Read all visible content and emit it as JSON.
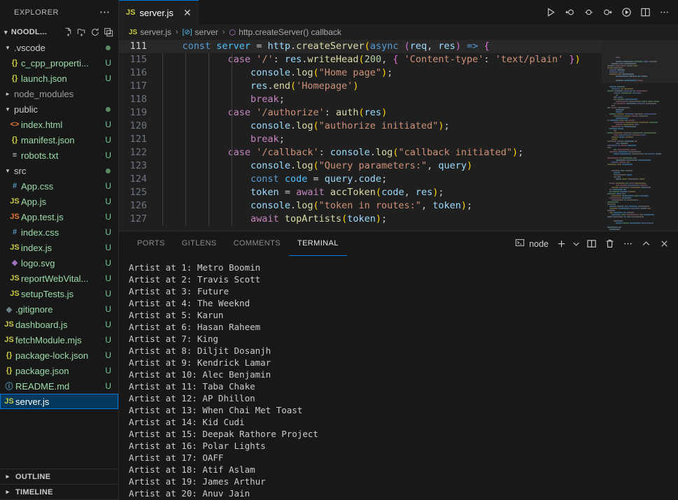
{
  "sidebar": {
    "title": "EXPLORER",
    "more_label": "⋯",
    "folder_name": "NOODL...",
    "actions": [
      {
        "name": "new-file-icon",
        "label": "New File"
      },
      {
        "name": "new-folder-icon",
        "label": "New Folder"
      },
      {
        "name": "refresh-icon",
        "label": "Refresh Explorer"
      },
      {
        "name": "collapse-all-icon",
        "label": "Collapse Folders in Explorer"
      }
    ],
    "tree": [
      {
        "label": ".vscode",
        "type": "folder",
        "expanded": true,
        "indent": 1,
        "icon": "",
        "badge": "dot",
        "cls": "d-folder"
      },
      {
        "label": "c_cpp_properti...",
        "type": "file",
        "indent": 2,
        "icon": "{}",
        "badge": "U",
        "cls": "json"
      },
      {
        "label": "launch.json",
        "type": "file",
        "indent": 2,
        "icon": "{}",
        "badge": "U",
        "cls": "json"
      },
      {
        "label": "node_modules",
        "type": "folder",
        "expanded": false,
        "indent": 1,
        "icon": "",
        "badge": "",
        "cls": "d-folder",
        "dim": true
      },
      {
        "label": "public",
        "type": "folder",
        "expanded": true,
        "indent": 1,
        "icon": "",
        "badge": "dot",
        "cls": "d-folder"
      },
      {
        "label": "index.html",
        "type": "file",
        "indent": 2,
        "icon": "<>",
        "badge": "U",
        "cls": "html"
      },
      {
        "label": "manifest.json",
        "type": "file",
        "indent": 2,
        "icon": "{}",
        "badge": "U",
        "cls": "json"
      },
      {
        "label": "robots.txt",
        "type": "file",
        "indent": 2,
        "icon": "≡",
        "badge": "U",
        "cls": "txt"
      },
      {
        "label": "src",
        "type": "folder",
        "expanded": true,
        "indent": 1,
        "icon": "",
        "badge": "dot",
        "cls": "d-folder"
      },
      {
        "label": "App.css",
        "type": "file",
        "indent": 2,
        "icon": "#",
        "badge": "U",
        "cls": "css"
      },
      {
        "label": "App.js",
        "type": "file",
        "indent": 2,
        "icon": "JS",
        "badge": "U",
        "cls": "js"
      },
      {
        "label": "App.test.js",
        "type": "file",
        "indent": 2,
        "icon": "JS",
        "badge": "U",
        "cls": "jst"
      },
      {
        "label": "index.css",
        "type": "file",
        "indent": 2,
        "icon": "#",
        "badge": "U",
        "cls": "css"
      },
      {
        "label": "index.js",
        "type": "file",
        "indent": 2,
        "icon": "JS",
        "badge": "U",
        "cls": "js"
      },
      {
        "label": "logo.svg",
        "type": "file",
        "indent": 2,
        "icon": "❖",
        "badge": "U",
        "cls": "svgc"
      },
      {
        "label": "reportWebVital...",
        "type": "file",
        "indent": 2,
        "icon": "JS",
        "badge": "U",
        "cls": "js"
      },
      {
        "label": "setupTests.js",
        "type": "file",
        "indent": 2,
        "icon": "JS",
        "badge": "U",
        "cls": "js"
      },
      {
        "label": ".gitignore",
        "type": "file",
        "indent": 1,
        "icon": "◆",
        "badge": "U",
        "cls": "git"
      },
      {
        "label": "dashboard.js",
        "type": "file",
        "indent": 1,
        "icon": "JS",
        "badge": "U",
        "cls": "js"
      },
      {
        "label": "fetchModule.mjs",
        "type": "file",
        "indent": 1,
        "icon": "JS",
        "badge": "U",
        "cls": "js"
      },
      {
        "label": "package-lock.json",
        "type": "file",
        "indent": 1,
        "icon": "{}",
        "badge": "U",
        "cls": "json"
      },
      {
        "label": "package.json",
        "type": "file",
        "indent": 1,
        "icon": "{}",
        "badge": "U",
        "cls": "json"
      },
      {
        "label": "README.md",
        "type": "file",
        "indent": 1,
        "icon": "ⓘ",
        "badge": "U",
        "cls": "md"
      },
      {
        "label": "server.js",
        "type": "file",
        "indent": 1,
        "icon": "JS",
        "badge": "",
        "cls": "js",
        "selected": true
      }
    ],
    "sections": [
      {
        "label": "OUTLINE",
        "expanded": false
      },
      {
        "label": "TIMELINE",
        "expanded": false
      }
    ]
  },
  "editor": {
    "tab": {
      "label": "server.js",
      "icon": "JS",
      "close": "✕"
    },
    "breadcrumb": [
      {
        "icon": "JS",
        "label": "server.js",
        "kind": "file"
      },
      {
        "icon": "[⊘]",
        "label": "server",
        "kind": "module"
      },
      {
        "icon": "⬡",
        "label": "http.createServer() callback",
        "kind": "function"
      }
    ],
    "toolbar": [
      {
        "name": "run-button",
        "label": "Run"
      },
      {
        "name": "step-back-button",
        "label": "Step Back"
      },
      {
        "name": "debug-restart-button",
        "label": "Restart"
      },
      {
        "name": "step-over-button",
        "label": "Step Over"
      },
      {
        "name": "run-and-debug-button",
        "label": "Run and Debug"
      },
      {
        "name": "split-editor-button",
        "label": "Split Editor Right"
      },
      {
        "name": "more-actions-button",
        "label": "More Actions..."
      }
    ],
    "lines": [
      {
        "num": "111",
        "current": true,
        "tokens": [
          {
            "t": "    ",
            "c": "pn"
          },
          {
            "t": "const",
            "c": "kw"
          },
          {
            "t": " ",
            "c": "pn"
          },
          {
            "t": "server",
            "c": "id"
          },
          {
            "t": " ",
            "c": "pn"
          },
          {
            "t": "=",
            "c": "pn"
          },
          {
            "t": " ",
            "c": "pn"
          },
          {
            "t": "http",
            "c": "var"
          },
          {
            "t": ".",
            "c": "pn"
          },
          {
            "t": "createServer",
            "c": "fn"
          },
          {
            "t": "(",
            "c": "y1"
          },
          {
            "t": "async",
            "c": "kw"
          },
          {
            "t": " ",
            "c": "pn"
          },
          {
            "t": "(",
            "c": "y2"
          },
          {
            "t": "req",
            "c": "var"
          },
          {
            "t": ", ",
            "c": "pn"
          },
          {
            "t": "res",
            "c": "var"
          },
          {
            "t": ")",
            "c": "y2"
          },
          {
            "t": " ",
            "c": "pn"
          },
          {
            "t": "=>",
            "c": "ar"
          },
          {
            "t": " ",
            "c": "pn"
          },
          {
            "t": "{",
            "c": "y2"
          }
        ]
      },
      {
        "num": "115",
        "current": false,
        "tokens": [
          {
            "t": "            ",
            "c": "pn"
          },
          {
            "t": "case",
            "c": "k"
          },
          {
            "t": " ",
            "c": "pn"
          },
          {
            "t": "'/'",
            "c": "str"
          },
          {
            "t": ": ",
            "c": "pn"
          },
          {
            "t": "res",
            "c": "var"
          },
          {
            "t": ".",
            "c": "pn"
          },
          {
            "t": "writeHead",
            "c": "fn"
          },
          {
            "t": "(",
            "c": "y1"
          },
          {
            "t": "200",
            "c": "num"
          },
          {
            "t": ", ",
            "c": "pn"
          },
          {
            "t": "{",
            "c": "y2"
          },
          {
            "t": " ",
            "c": "pn"
          },
          {
            "t": "'Content-type'",
            "c": "str"
          },
          {
            "t": ": ",
            "c": "pn"
          },
          {
            "t": "'text/plain'",
            "c": "str"
          },
          {
            "t": " ",
            "c": "pn"
          },
          {
            "t": "}",
            "c": "y2"
          },
          {
            "t": ")",
            "c": "y1"
          }
        ]
      },
      {
        "num": "116",
        "current": false,
        "tokens": [
          {
            "t": "                ",
            "c": "pn"
          },
          {
            "t": "console",
            "c": "var"
          },
          {
            "t": ".",
            "c": "pn"
          },
          {
            "t": "log",
            "c": "fn"
          },
          {
            "t": "(",
            "c": "y1"
          },
          {
            "t": "\"Home page\"",
            "c": "str"
          },
          {
            "t": ")",
            "c": "y1"
          },
          {
            "t": ";",
            "c": "pn"
          }
        ]
      },
      {
        "num": "117",
        "current": false,
        "tokens": [
          {
            "t": "                ",
            "c": "pn"
          },
          {
            "t": "res",
            "c": "var"
          },
          {
            "t": ".",
            "c": "pn"
          },
          {
            "t": "end",
            "c": "fn"
          },
          {
            "t": "(",
            "c": "y1"
          },
          {
            "t": "'Homepage'",
            "c": "str"
          },
          {
            "t": ")",
            "c": "y1"
          }
        ]
      },
      {
        "num": "118",
        "current": false,
        "tokens": [
          {
            "t": "                ",
            "c": "pn"
          },
          {
            "t": "break",
            "c": "k"
          },
          {
            "t": ";",
            "c": "pn"
          }
        ]
      },
      {
        "num": "119",
        "current": false,
        "tokens": [
          {
            "t": "            ",
            "c": "pn"
          },
          {
            "t": "case",
            "c": "k"
          },
          {
            "t": " ",
            "c": "pn"
          },
          {
            "t": "'/authorize'",
            "c": "str"
          },
          {
            "t": ": ",
            "c": "pn"
          },
          {
            "t": "auth",
            "c": "fn"
          },
          {
            "t": "(",
            "c": "y1"
          },
          {
            "t": "res",
            "c": "var"
          },
          {
            "t": ")",
            "c": "y1"
          }
        ]
      },
      {
        "num": "120",
        "current": false,
        "tokens": [
          {
            "t": "                ",
            "c": "pn"
          },
          {
            "t": "console",
            "c": "var"
          },
          {
            "t": ".",
            "c": "pn"
          },
          {
            "t": "log",
            "c": "fn"
          },
          {
            "t": "(",
            "c": "y1"
          },
          {
            "t": "\"authorize initiated\"",
            "c": "str"
          },
          {
            "t": ")",
            "c": "y1"
          },
          {
            "t": ";",
            "c": "pn"
          }
        ]
      },
      {
        "num": "121",
        "current": false,
        "tokens": [
          {
            "t": "                ",
            "c": "pn"
          },
          {
            "t": "break",
            "c": "k"
          },
          {
            "t": ";",
            "c": "pn"
          }
        ]
      },
      {
        "num": "122",
        "current": false,
        "tokens": [
          {
            "t": "            ",
            "c": "pn"
          },
          {
            "t": "case",
            "c": "k"
          },
          {
            "t": " ",
            "c": "pn"
          },
          {
            "t": "'/callback'",
            "c": "str"
          },
          {
            "t": ": ",
            "c": "pn"
          },
          {
            "t": "console",
            "c": "var"
          },
          {
            "t": ".",
            "c": "pn"
          },
          {
            "t": "log",
            "c": "fn"
          },
          {
            "t": "(",
            "c": "y1"
          },
          {
            "t": "\"callback initiated\"",
            "c": "str"
          },
          {
            "t": ")",
            "c": "y1"
          },
          {
            "t": ";",
            "c": "pn"
          }
        ]
      },
      {
        "num": "123",
        "current": false,
        "tokens": [
          {
            "t": "                ",
            "c": "pn"
          },
          {
            "t": "console",
            "c": "var"
          },
          {
            "t": ".",
            "c": "pn"
          },
          {
            "t": "log",
            "c": "fn"
          },
          {
            "t": "(",
            "c": "y1"
          },
          {
            "t": "\"Query parameters:\"",
            "c": "str"
          },
          {
            "t": ", ",
            "c": "pn"
          },
          {
            "t": "query",
            "c": "var"
          },
          {
            "t": ")",
            "c": "y1"
          }
        ]
      },
      {
        "num": "124",
        "current": false,
        "tokens": [
          {
            "t": "                ",
            "c": "pn"
          },
          {
            "t": "const",
            "c": "kw"
          },
          {
            "t": " ",
            "c": "pn"
          },
          {
            "t": "code",
            "c": "id"
          },
          {
            "t": " ",
            "c": "pn"
          },
          {
            "t": "=",
            "c": "pn"
          },
          {
            "t": " ",
            "c": "pn"
          },
          {
            "t": "query",
            "c": "var"
          },
          {
            "t": ".",
            "c": "pn"
          },
          {
            "t": "code",
            "c": "var"
          },
          {
            "t": ";",
            "c": "pn"
          }
        ]
      },
      {
        "num": "125",
        "current": false,
        "tokens": [
          {
            "t": "                ",
            "c": "pn"
          },
          {
            "t": "token",
            "c": "var"
          },
          {
            "t": " ",
            "c": "pn"
          },
          {
            "t": "=",
            "c": "pn"
          },
          {
            "t": " ",
            "c": "pn"
          },
          {
            "t": "await",
            "c": "k"
          },
          {
            "t": " ",
            "c": "pn"
          },
          {
            "t": "accToken",
            "c": "fn"
          },
          {
            "t": "(",
            "c": "y1"
          },
          {
            "t": "code",
            "c": "var"
          },
          {
            "t": ", ",
            "c": "pn"
          },
          {
            "t": "res",
            "c": "var"
          },
          {
            "t": ")",
            "c": "y1"
          },
          {
            "t": ";",
            "c": "pn"
          }
        ]
      },
      {
        "num": "126",
        "current": false,
        "tokens": [
          {
            "t": "                ",
            "c": "pn"
          },
          {
            "t": "console",
            "c": "var"
          },
          {
            "t": ".",
            "c": "pn"
          },
          {
            "t": "log",
            "c": "fn"
          },
          {
            "t": "(",
            "c": "y1"
          },
          {
            "t": "\"token in routes:\"",
            "c": "str"
          },
          {
            "t": ", ",
            "c": "pn"
          },
          {
            "t": "token",
            "c": "var"
          },
          {
            "t": ")",
            "c": "y1"
          },
          {
            "t": ";",
            "c": "pn"
          }
        ]
      },
      {
        "num": "127",
        "current": false,
        "tokens": [
          {
            "t": "                ",
            "c": "pn"
          },
          {
            "t": "await",
            "c": "k"
          },
          {
            "t": " ",
            "c": "pn"
          },
          {
            "t": "topArtists",
            "c": "fn"
          },
          {
            "t": "(",
            "c": "y1"
          },
          {
            "t": "token",
            "c": "var"
          },
          {
            "t": ")",
            "c": "y1"
          },
          {
            "t": ";",
            "c": "pn"
          }
        ]
      }
    ]
  },
  "panel": {
    "tabs": [
      {
        "label": "PORTS",
        "active": false
      },
      {
        "label": "GITLENS",
        "active": false
      },
      {
        "label": "COMMENTS",
        "active": false
      },
      {
        "label": "TERMINAL",
        "active": true
      }
    ],
    "terminal_name": "node",
    "actions": [
      {
        "name": "new-terminal-icon",
        "label": "+"
      },
      {
        "name": "chevron-down-icon",
        "label": "⌄"
      },
      {
        "name": "split-terminal-icon",
        "label": "Split Terminal"
      },
      {
        "name": "kill-terminal-icon",
        "label": "Kill Terminal"
      },
      {
        "name": "more-actions-icon",
        "label": "⋯"
      },
      {
        "name": "maximize-panel-icon",
        "label": "^"
      },
      {
        "name": "close-panel-icon",
        "label": "✕"
      }
    ],
    "output": [
      "Artist at 1: Metro Boomin",
      "Artist at 2: Travis Scott",
      "Artist at 3: Future",
      "Artist at 4: The Weeknd",
      "Artist at 5: Karun",
      "Artist at 6: Hasan Raheem",
      "Artist at 7: King",
      "Artist at 8: Diljit Dosanjh",
      "Artist at 9: Kendrick Lamar",
      "Artist at 10: Alec Benjamin",
      "Artist at 11: Taba Chake",
      "Artist at 12: AP Dhillon",
      "Artist at 13: When Chai Met Toast",
      "Artist at 14: Kid Cudi",
      "Artist at 15: Deepak Rathore Project",
      "Artist at 16: Polar Lights",
      "Artist at 17: OAFF",
      "Artist at 18: Atif Aslam",
      "Artist at 19: James Arthur",
      "Artist at 20: Anuv Jain"
    ]
  },
  "colors": {
    "accent": "#0078d4",
    "selection_bg": "#04395e",
    "badge_green": "#73c991",
    "editor_bg": "#1f1f1f",
    "sidebar_bg": "#181818"
  }
}
